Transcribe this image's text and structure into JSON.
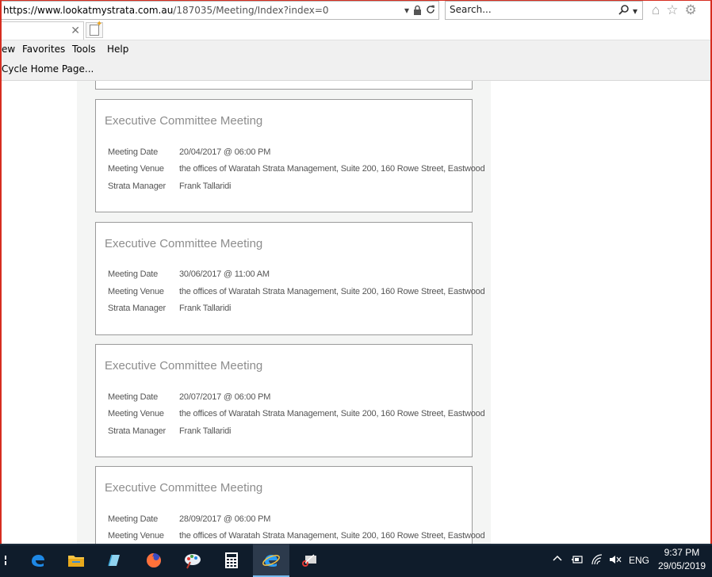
{
  "browser": {
    "url_host": "https://www.lookatmystrata.com.au",
    "url_path": "/187035/Meeting/Index?index=0",
    "search_placeholder": "Search...",
    "menu": [
      "ew",
      "Favorites",
      "Tools",
      "Help"
    ],
    "favorite": "Cycle Home Page..."
  },
  "meetings": [
    {
      "title": "Executive Committee Meeting",
      "rows": [
        {
          "label": "Meeting Date",
          "value": "20/04/2017 @ 06:00 PM"
        },
        {
          "label": "Meeting Venue",
          "value": "the offices of Waratah Strata Management, Suite 200, 160 Rowe Street, Eastwood"
        },
        {
          "label": "Strata Manager",
          "value": "Frank Tallaridi"
        }
      ]
    },
    {
      "title": "Executive Committee Meeting",
      "rows": [
        {
          "label": "Meeting Date",
          "value": "30/06/2017 @ 11:00 AM"
        },
        {
          "label": "Meeting Venue",
          "value": "the offices of Waratah Strata Management, Suite 200, 160 Rowe Street, Eastwood"
        },
        {
          "label": "Strata Manager",
          "value": "Frank Tallaridi"
        }
      ]
    },
    {
      "title": "Executive Committee Meeting",
      "rows": [
        {
          "label": "Meeting Date",
          "value": "20/07/2017 @ 06:00 PM"
        },
        {
          "label": "Meeting Venue",
          "value": "the offices of Waratah Strata Management, Suite 200, 160 Rowe Street, Eastwood"
        },
        {
          "label": "Strata Manager",
          "value": "Frank Tallaridi"
        }
      ]
    },
    {
      "title": "Executive Committee Meeting",
      "rows": [
        {
          "label": "Meeting Date",
          "value": "28/09/2017 @ 06:00 PM"
        },
        {
          "label": "Meeting Venue",
          "value": "the offices of Waratah Strata Management, Suite 200, 160 Rowe Street, Eastwood"
        }
      ]
    }
  ],
  "taskbar": {
    "apps": [
      "edge-icon",
      "file-explorer-icon",
      "notepad-icon",
      "firefox-icon",
      "paint-icon",
      "calculator-icon",
      "internet-explorer-icon",
      "snipping-tool-icon"
    ],
    "active_app": "internet-explorer-icon",
    "language": "ENG",
    "time": "9:37 PM",
    "date": "29/05/2019"
  },
  "colors": {
    "window_frame": "#d62d20",
    "card_title": "#8d8d8d",
    "column_bg": "#f4f5f4",
    "taskbar_bg": "#0f1c2b"
  }
}
